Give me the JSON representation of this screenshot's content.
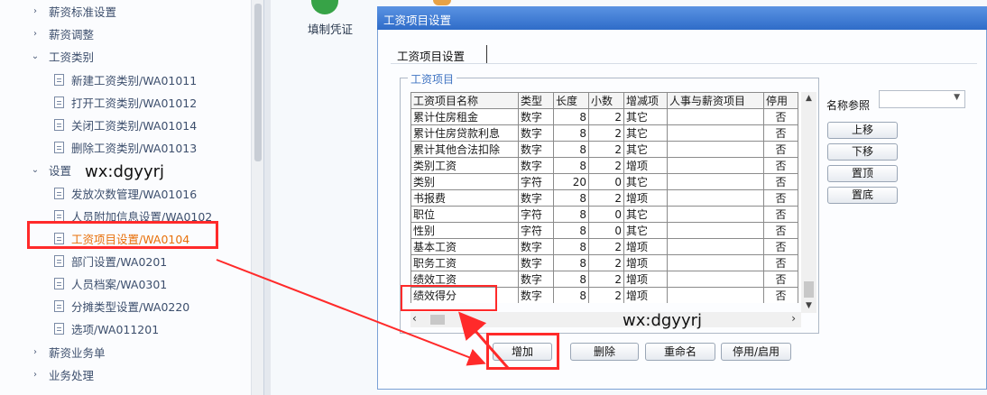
{
  "nav": {
    "items": [
      {
        "label": "薪资标准设置",
        "kind": "group-collapsed"
      },
      {
        "label": "薪资调整",
        "kind": "group-collapsed"
      },
      {
        "label": "工资类别",
        "kind": "group-expanded"
      },
      {
        "label": "新建工资类别/WA01011",
        "kind": "leaf"
      },
      {
        "label": "打开工资类别/WA01012",
        "kind": "leaf"
      },
      {
        "label": "关闭工资类别/WA01014",
        "kind": "leaf"
      },
      {
        "label": "删除工资类别/WA01013",
        "kind": "leaf"
      },
      {
        "label": "设置",
        "kind": "group-expanded"
      },
      {
        "label": "发放次数管理/WA01016",
        "kind": "leaf"
      },
      {
        "label": "人员附加信息设置/WA0102",
        "kind": "leaf"
      },
      {
        "label": "工资项目设置/WA0104",
        "kind": "leaf-selected"
      },
      {
        "label": "部门设置/WA0201",
        "kind": "leaf"
      },
      {
        "label": "人员档案/WA0301",
        "kind": "leaf"
      },
      {
        "label": "分摊类型设置/WA0220",
        "kind": "leaf"
      },
      {
        "label": "选项/WA011201",
        "kind": "leaf"
      },
      {
        "label": "薪资业务单",
        "kind": "group-collapsed"
      },
      {
        "label": "业务处理",
        "kind": "group-collapsed"
      }
    ],
    "watermark": "wx:dgyyrj"
  },
  "toolbar": {
    "voucher_label": "填制凭证"
  },
  "dialog": {
    "title": "工资项目设置",
    "tab_label": "工资项目设置",
    "group_label": "工资项目",
    "watermark": "wx:dgyyrj",
    "table": {
      "columns": [
        "工资项目名称",
        "类型",
        "长度",
        "小数",
        "增减项",
        "人事与薪资项目",
        "停用"
      ],
      "rows": [
        [
          "累计住房租金",
          "数字",
          "8",
          "2",
          "其它",
          "",
          "否"
        ],
        [
          "累计住房贷款利息",
          "数字",
          "8",
          "2",
          "其它",
          "",
          "否"
        ],
        [
          "累计其他合法扣除",
          "数字",
          "8",
          "2",
          "其它",
          "",
          "否"
        ],
        [
          "类别工资",
          "数字",
          "8",
          "2",
          "增项",
          "",
          "否"
        ],
        [
          "类别",
          "字符",
          "20",
          "0",
          "其它",
          "",
          "否"
        ],
        [
          "书报费",
          "数字",
          "8",
          "2",
          "增项",
          "",
          "否"
        ],
        [
          "职位",
          "字符",
          "8",
          "0",
          "其它",
          "",
          "否"
        ],
        [
          "性别",
          "字符",
          "8",
          "0",
          "其它",
          "",
          "否"
        ],
        [
          "基本工资",
          "数字",
          "8",
          "2",
          "增项",
          "",
          "否"
        ],
        [
          "职务工资",
          "数字",
          "8",
          "2",
          "增项",
          "",
          "否"
        ],
        [
          "绩效工资",
          "数字",
          "8",
          "2",
          "增项",
          "",
          "否"
        ],
        [
          "绩效得分",
          "数字",
          "8",
          "2",
          "增项",
          "",
          "否"
        ]
      ]
    },
    "sort": {
      "label": "名称参照",
      "value": ""
    },
    "side_buttons": [
      "上移",
      "下移",
      "置顶",
      "置底"
    ],
    "bottom_buttons": [
      "增加",
      "删除",
      "重命名",
      "停用/启用"
    ],
    "accent": "#ff2a2a"
  }
}
